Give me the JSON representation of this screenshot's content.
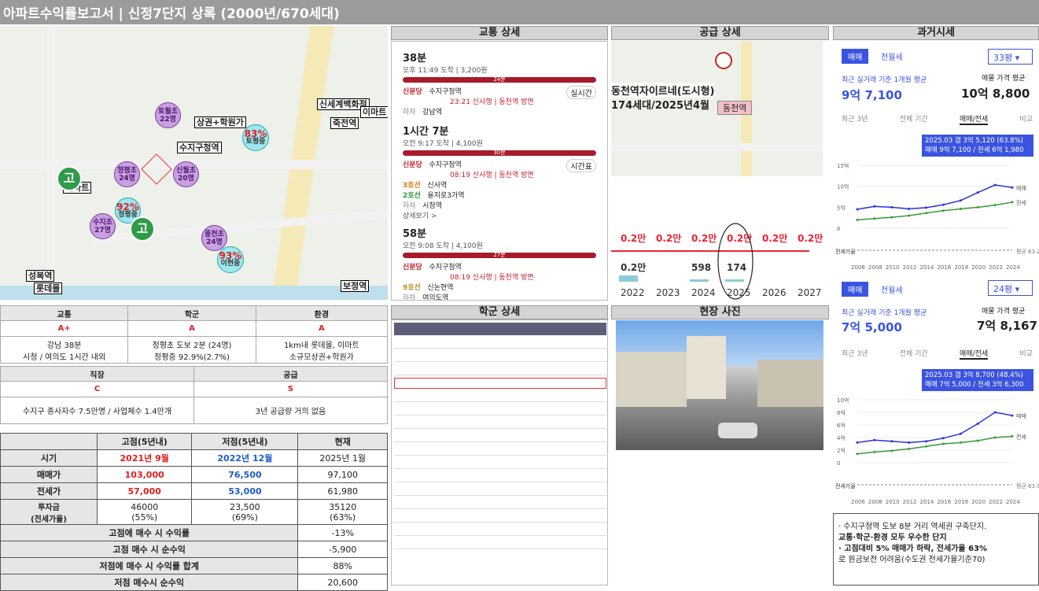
{
  "title": "아파트수익률보고서 | 신정7단지 상록 (2000년/670세대)",
  "sections": {
    "traffic": "교통 상세",
    "supply": "공급 상세",
    "history": "과거시세",
    "school": "학군 상세",
    "photo": "현장 사진"
  },
  "map_labels": {
    "shopping": "상권+학원가",
    "suji_station": "수지구청역",
    "emart1": "이마트",
    "shinsegae": "신세계백화점",
    "emart2": "이마트",
    "jukjeon": "죽전역",
    "seongbok": "성복역",
    "lotte": "롯데몰",
    "bojeong": "보정역"
  },
  "map_circles": [
    {
      "name": "토월초",
      "sub": "22명"
    },
    {
      "name": "83%",
      "sub": "토평중"
    },
    {
      "name": "정평초",
      "sub": "24명"
    },
    {
      "name": "신월초",
      "sub": "20명"
    },
    {
      "name": "92%",
      "sub": "정평중"
    },
    {
      "name": "수지초",
      "sub": "27명"
    },
    {
      "name": "풍천초",
      "sub": "24명"
    },
    {
      "name": "93%",
      "sub": "이현중"
    }
  ],
  "high_school": "고",
  "eval": {
    "h_traffic": "교통",
    "h_school": "학군",
    "h_env": "환경",
    "g_traffic": "A+",
    "g_school": "A",
    "g_env": "A",
    "d_traffic1": "강남 38분",
    "d_traffic2": "시청 / 여의도 1시간 내외",
    "d_school1": "정평초 도보 2분 (24명)",
    "d_school2": "정평중 92.9%(2.7%)",
    "d_env1": "1km내 롯데몰, 이마트",
    "d_env2": "소규모상권+학원가",
    "h_job": "직장",
    "h_supply": "공급",
    "g_job": "C",
    "g_supply": "S",
    "d_job": "수지구 종사자수 7.5만명 / 사업체수 1.4만개",
    "d_supply": "3년 공급량 거의 없음"
  },
  "history_table": {
    "headers": [
      "",
      "고점(5년내)",
      "저점(5년내)",
      "현재"
    ],
    "rows": [
      [
        "시기",
        "2021년 9월",
        "2022년 12월",
        "2025년 1월"
      ],
      [
        "매매가",
        "103,000",
        "76,500",
        "97,100"
      ],
      [
        "전세가",
        "57,000",
        "53,000",
        "61,980"
      ],
      [
        "투자금\n(전세가율)",
        "46000\n(55%)",
        "23,500\n(69%)",
        "35120\n(63%)"
      ]
    ],
    "summary": [
      [
        "고점에 매수 시 수익률",
        "-13%"
      ],
      [
        "고점 매수 시 순수익",
        "-5,900"
      ],
      [
        "저점에 매수 시 수익률 합계",
        "88%"
      ],
      [
        "저점 매수시 순수익",
        "20,600"
      ]
    ]
  },
  "traffic": {
    "r1_time": "38분",
    "r1_info": "오후 11:49 도착 | 3,200원",
    "r1_bar": "24분",
    "r1_from": "신분당",
    "r1_station": "수지구청역",
    "r1_sub": "23:21 신사행 | 동천역 방면",
    "r1_off": "하차",
    "r1_dest": "강남역",
    "r2_time": "1시간 7분",
    "r2_info": "오전 9:17 도착 | 4,100원",
    "r2_bar": "30분",
    "r2_from": "신분당",
    "r2_station": "수지구청역",
    "r2_sub": "08:19 신사행 | 동천역 방면",
    "r2_line3": "3호선",
    "r2_st3": "신사역",
    "r2_line2": "2호선",
    "r2_st2": "을지로3가역",
    "r2_off": "하차",
    "r2_dest": "시청역",
    "more": "상세보기 >",
    "r3_time": "58분",
    "r3_info": "오전 9:08 도착 | 4,100원",
    "r3_bar": "27분",
    "r3_from": "신분당",
    "r3_station": "수지구청역",
    "r3_sub": "08:19 신사행 | 동천역 방면",
    "r3_line9": "9호선",
    "r3_st9": "신논현역",
    "r3_off": "하차",
    "r3_dest": "여의도역",
    "btn_a": "실시간",
    "btn_b": "시간표"
  },
  "supply": {
    "name": "동천역자이르네(도시형)",
    "units": "174세대/2025년4월",
    "station": "동천역",
    "avg": [
      "0.2만",
      "0.2만",
      "0.2만",
      "0.2만",
      "0.2만",
      "0.2만"
    ],
    "bars": [
      "0.2만",
      "",
      "598",
      "174",
      "",
      ""
    ],
    "years": [
      "2022",
      "2023",
      "2024",
      "2025",
      "2026",
      "2027"
    ]
  },
  "chart_data": [
    {
      "type": "line",
      "title": "",
      "tabs": [
        "매매",
        "전월세"
      ],
      "size": "33평",
      "caption": "최근 실거래 기준 1개월 평균",
      "avg_label": "매물 가격 평균",
      "recent": "9억 7,100",
      "avg": "10억 8,800",
      "periods": [
        "최근 3년",
        "전체 기간",
        "매매/전세",
        "비교"
      ],
      "tooltip1": "2025.03 갭 3억 5,120 (63.8%)",
      "tooltip2": "매매 9억 7,100 / 전세 6억 1,980",
      "yticks": [
        "15억",
        "10억",
        "5억",
        "0"
      ],
      "x": [
        "2006",
        "2008",
        "2010",
        "2012",
        "2014",
        "2016",
        "2018",
        "2020",
        "2022",
        "2024"
      ],
      "series": [
        {
          "name": "매매",
          "values": [
            4.5,
            5.2,
            5.0,
            4.6,
            4.9,
            5.6,
            6.6,
            8.5,
            10.3,
            9.7
          ]
        },
        {
          "name": "전세",
          "values": [
            2.0,
            2.3,
            2.6,
            3.0,
            3.6,
            4.2,
            4.6,
            5.0,
            5.5,
            6.2
          ]
        }
      ],
      "ratio_label": "전세가율",
      "ratio_note": "평균 63.2%",
      "ylim": [
        0,
        15
      ]
    },
    {
      "type": "line",
      "title": "",
      "tabs": [
        "매매",
        "전월세"
      ],
      "size": "24평",
      "caption": "최근 실거래 기준 1개월 평균",
      "avg_label": "매물 가격 평균",
      "recent": "7억 5,000",
      "avg": "7억 8,167",
      "periods": [
        "최근 3년",
        "전체 기간",
        "매매/전세",
        "비교"
      ],
      "tooltip1": "2025.03 갭 3억 8,700 (48.4%)",
      "tooltip2": "매매 7억 5,000 / 전세 3억 6,300",
      "yticks": [
        "10억",
        "8억",
        "6억",
        "4억",
        "2억",
        "0"
      ],
      "x": [
        "2006",
        "2008",
        "2010",
        "2012",
        "2014",
        "2016",
        "2018",
        "2020",
        "2022",
        "2024"
      ],
      "series": [
        {
          "name": "매매",
          "values": [
            3.2,
            3.6,
            3.4,
            3.2,
            3.4,
            3.9,
            4.6,
            6.2,
            8.0,
            7.5
          ]
        },
        {
          "name": "전세",
          "values": [
            1.4,
            1.7,
            1.9,
            2.2,
            2.6,
            3.0,
            3.2,
            3.5,
            4.0,
            4.2
          ]
        }
      ],
      "ratio_label": "전세가율",
      "ratio_note": "평균 63.9%",
      "ylim": [
        0,
        10
      ]
    }
  ],
  "notes": [
    "· 수지구청역 도보 8분 거리 역세권 구축단지.",
    "교통·학군·환경 모두 우수한 단지",
    "· 고점대비 5% 매매가 하락, 전세가율 63%",
    "로 원금보전 어려움(수도권 전세가율기준70)"
  ]
}
